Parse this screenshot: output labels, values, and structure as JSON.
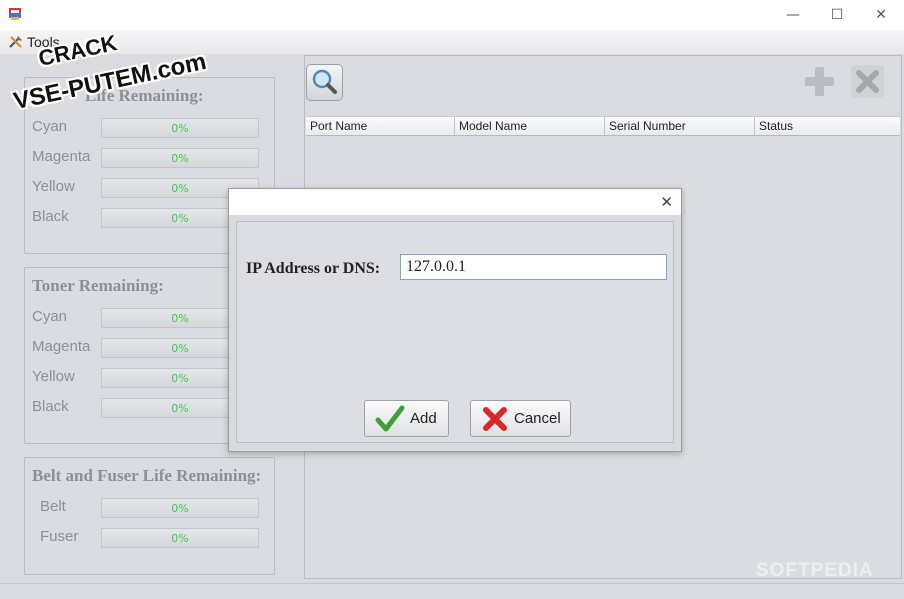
{
  "window": {
    "app_icon": "printer-app-icon",
    "controls": {
      "minimize": "—",
      "maximize": "☐",
      "close": "✕"
    }
  },
  "menu": {
    "tools_label": "Tools",
    "tools_icon": "tools-icon"
  },
  "watermark": {
    "line1": "CRACK",
    "line2": "VSE-PUTEM.com"
  },
  "drum_panel": {
    "title": "Life Remaining:",
    "rows": [
      {
        "label": "Cyan",
        "value": "0%"
      },
      {
        "label": "Magenta",
        "value": "0%"
      },
      {
        "label": "Yellow",
        "value": "0%"
      },
      {
        "label": "Black",
        "value": "0%"
      }
    ]
  },
  "toner_panel": {
    "title": "Toner Remaining:",
    "rows": [
      {
        "label": "Cyan",
        "value": "0%"
      },
      {
        "label": "Magenta",
        "value": "0%"
      },
      {
        "label": "Yellow",
        "value": "0%"
      },
      {
        "label": "Black",
        "value": "0%"
      }
    ]
  },
  "belt_panel": {
    "title": "Belt and Fuser Life Remaining:",
    "rows": [
      {
        "label": "Belt",
        "value": "0%"
      },
      {
        "label": "Fuser",
        "value": "0%"
      }
    ]
  },
  "toolbar": {
    "search_icon": "search-icon",
    "add_icon": "plus-icon",
    "remove_icon": "x-icon"
  },
  "table": {
    "columns": [
      "Port Name",
      "Model Name",
      "Serial Number",
      "Status"
    ]
  },
  "dialog": {
    "ip_label": "IP Address or DNS:",
    "ip_value": "127.0.0.1",
    "add_label": "Add",
    "cancel_label": "Cancel",
    "close_glyph": "✕"
  },
  "footer_watermark": "SOFTPEDIA",
  "colors": {
    "percent_text": "#41c94b",
    "accent_border": "#7ea4d0"
  }
}
